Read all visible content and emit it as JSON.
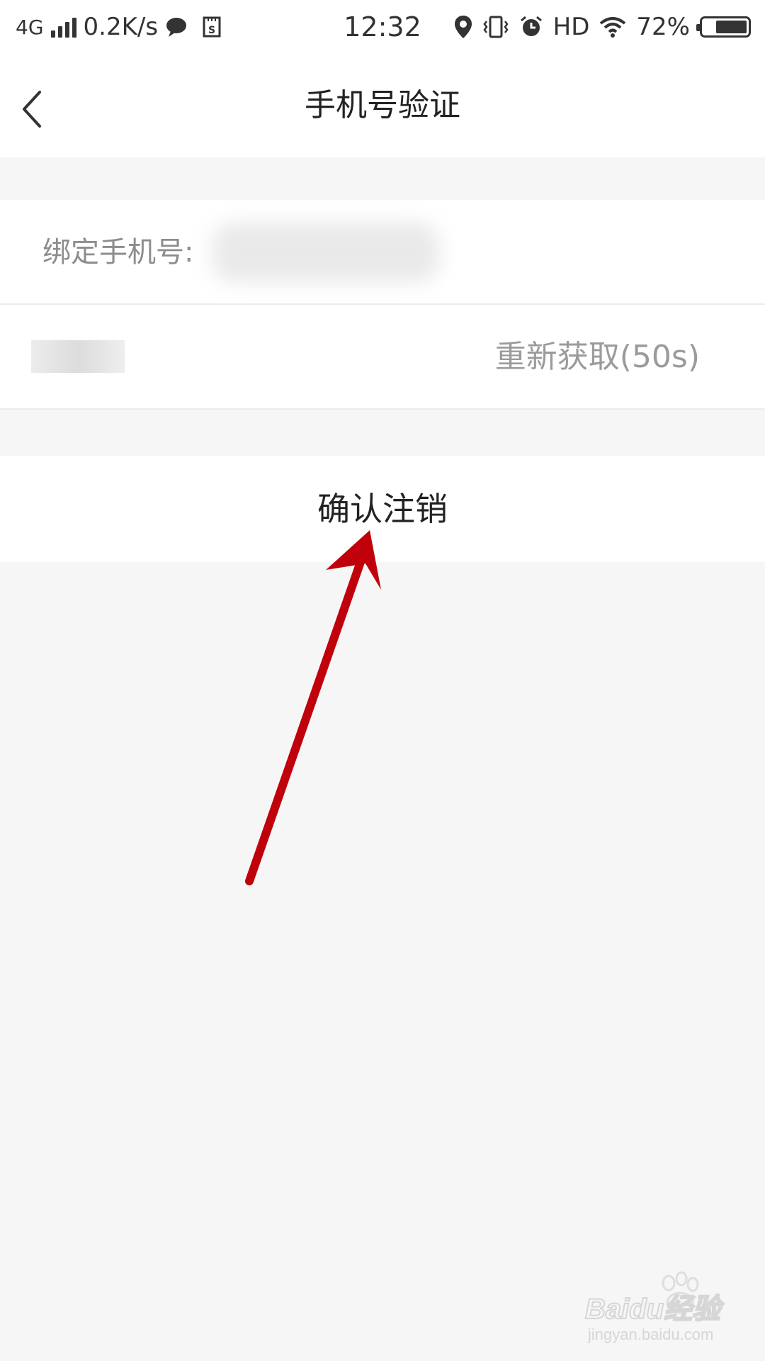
{
  "status_bar": {
    "network": "4G",
    "speed": "0.2K/s",
    "time": "12:32",
    "hd": "HD",
    "battery_percent": "72%",
    "battery_level": 0.72,
    "icons": [
      "signal-icon",
      "chat-bubble-icon",
      "sim-icon",
      "location-icon",
      "vibrate-icon",
      "alarm-icon",
      "wifi-icon",
      "battery-icon"
    ]
  },
  "nav": {
    "title": "手机号验证",
    "back_icon": "chevron-left-icon"
  },
  "form": {
    "phone_label": "绑定手机号:",
    "resend_label": "重新获取(50s)"
  },
  "confirm": {
    "label": "确认注销"
  },
  "annotation": {
    "arrow_color": "#c0000a"
  },
  "watermark": {
    "brand": "Baidu经验",
    "url": "jingyan.baidu.com"
  },
  "colors": {
    "page_background": "#f6f6f6",
    "card_background": "#ffffff",
    "label_gray": "#8d8d8d",
    "resend_gray": "#9b9b9b"
  }
}
